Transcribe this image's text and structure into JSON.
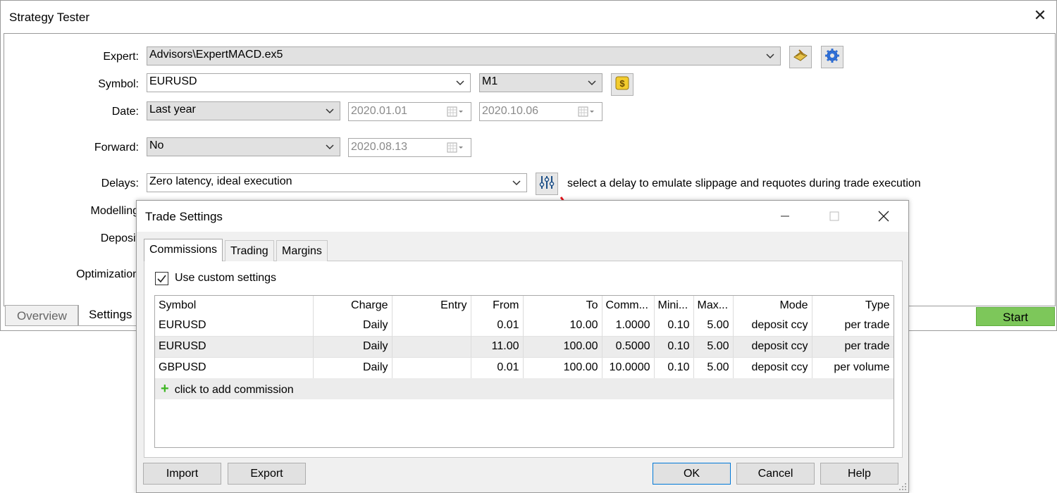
{
  "tester": {
    "title": "Strategy Tester",
    "expert_label": "Expert:",
    "expert_value": "Advisors\\ExpertMACD.ex5",
    "symbol_label": "Symbol:",
    "symbol_value": "EURUSD",
    "period_value": "M1",
    "date_label": "Date:",
    "date_range_value": "Last year",
    "date_from": "2020.01.01",
    "date_to": "2020.10.06",
    "forward_label": "Forward:",
    "forward_value": "No",
    "forward_date": "2020.08.13",
    "delays_label": "Delays:",
    "delays_value": "Zero latency, ideal execution",
    "delays_hint": "select a delay to emulate slippage and requotes during trade execution",
    "modelling_label": "Modelling",
    "deposit_label": "Deposit",
    "optimization_label": "Optimization",
    "tabs": [
      "Overview",
      "Settings"
    ],
    "start_label": "Start"
  },
  "dialog": {
    "title": "Trade Settings",
    "tabs": [
      "Commissions",
      "Trading",
      "Margins"
    ],
    "use_custom_label": "Use custom settings",
    "use_custom_checked": true,
    "columns": [
      "Symbol",
      "Charge",
      "Entry",
      "From",
      "To",
      "Comm...",
      "Mini...",
      "Max...",
      "Mode",
      "Type"
    ],
    "rows": [
      [
        "EURUSD",
        "Daily",
        "",
        "0.01",
        "10.00",
        "1.0000",
        "0.10",
        "5.00",
        "deposit ccy",
        "per trade"
      ],
      [
        "EURUSD",
        "Daily",
        "",
        "11.00",
        "100.00",
        "0.5000",
        "0.10",
        "5.00",
        "deposit ccy",
        "per trade"
      ],
      [
        "GBPUSD",
        "Daily",
        "",
        "0.01",
        "100.00",
        "10.0000",
        "0.10",
        "5.00",
        "deposit ccy",
        "per volume"
      ]
    ],
    "add_label": "click to add commission",
    "buttons": {
      "import": "Import",
      "export": "Export",
      "ok": "OK",
      "cancel": "Cancel",
      "help": "Help"
    }
  },
  "colors": {
    "start_button": "#7dc75a",
    "arrow": "#e8141b",
    "add_icon": "#3cb521",
    "combo_grey": "#e1e1e1"
  }
}
